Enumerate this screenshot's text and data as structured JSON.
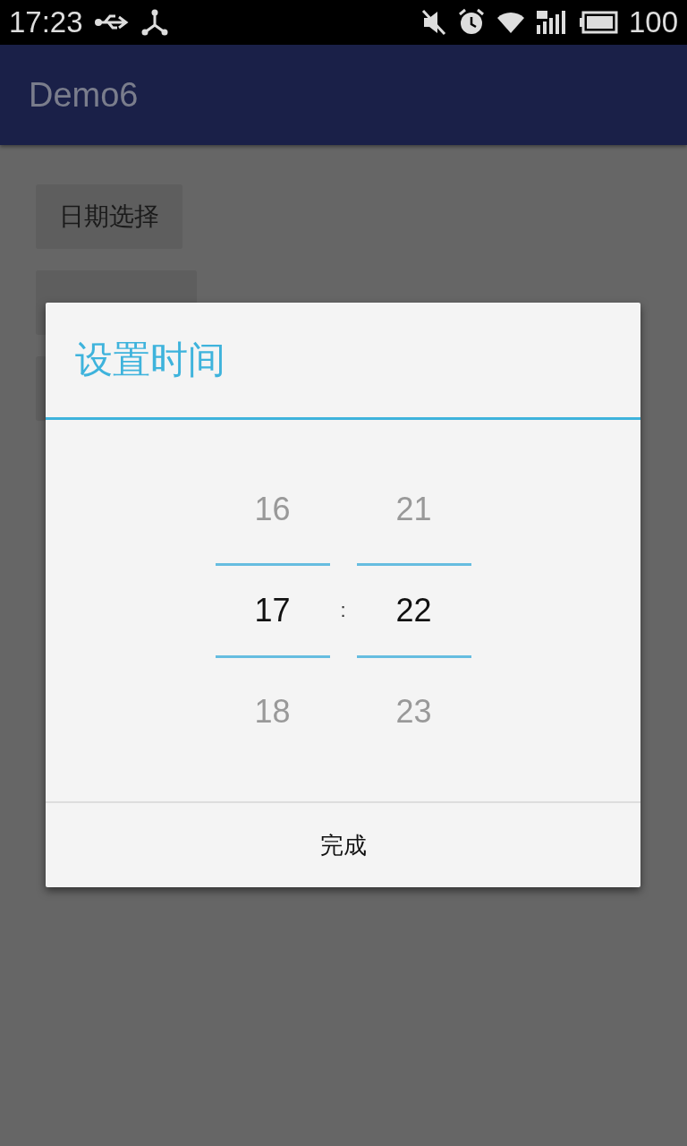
{
  "status_bar": {
    "time": "17:23",
    "battery": "100"
  },
  "app_bar": {
    "title": "Demo6"
  },
  "buttons": [
    {
      "label": "日期选择"
    }
  ],
  "dialog": {
    "title": "设置时间",
    "separator": ":",
    "rows": [
      {
        "hour": "16",
        "minute": "21",
        "selected": false
      },
      {
        "hour": "17",
        "minute": "22",
        "selected": true
      },
      {
        "hour": "18",
        "minute": "23",
        "selected": false
      }
    ],
    "action": "完成"
  }
}
